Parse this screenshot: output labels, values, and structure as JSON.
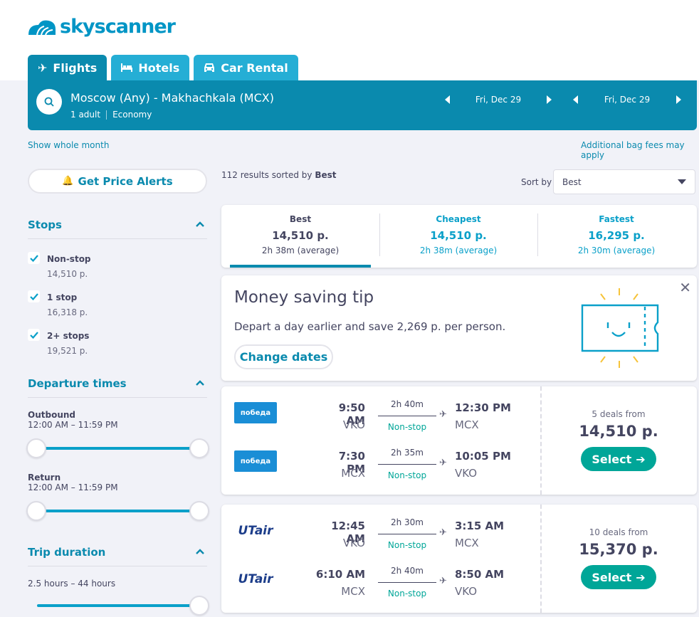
{
  "brand": {
    "name": "skyscanner",
    "color": "#0a8aae",
    "accent": "#00a698"
  },
  "tabs": [
    {
      "label": "Flights",
      "icon": "plane-icon"
    },
    {
      "label": "Hotels",
      "icon": "bed-icon"
    },
    {
      "label": "Car Rental",
      "icon": "car-icon"
    }
  ],
  "search": {
    "route": "Moscow (Any) - Makhachkala (MCX)",
    "travellers": "1 adult",
    "cabin": "Economy",
    "depart_date": "Fri, Dec 29",
    "return_date": "Fri, Dec 29"
  },
  "links": {
    "whole_month": "Show whole month",
    "bag_fees": "Additional bag fees may apply"
  },
  "sidebar": {
    "price_alerts": "Get Price Alerts",
    "stops": {
      "title": "Stops",
      "options": [
        {
          "label": "Non-stop",
          "price": "14,510 р."
        },
        {
          "label": "1 stop",
          "price": "16,318 р."
        },
        {
          "label": "2+ stops",
          "price": "19,521 р."
        }
      ]
    },
    "departure": {
      "title": "Departure times",
      "outbound_label": "Outbound",
      "outbound_range": "12:00 AM – 11:59 PM",
      "return_label": "Return",
      "return_range": "12:00 AM – 11:59 PM"
    },
    "duration": {
      "title": "Trip duration",
      "range": "2.5 hours – 44 hours"
    }
  },
  "results": {
    "count_text": "112 results sorted by ",
    "sorted_by": "Best",
    "sort_label": "Sort by",
    "sort_value": "Best"
  },
  "sort_tabs": [
    {
      "title": "Best",
      "price": "14,510 р.",
      "duration": "2h 38m (average)"
    },
    {
      "title": "Cheapest",
      "price": "14,510 р.",
      "duration": "2h 38m (average)"
    },
    {
      "title": "Fastest",
      "price": "16,295 р.",
      "duration": "2h 30m (average)"
    }
  ],
  "tip": {
    "title": "Money saving tip",
    "text": "Depart a day earlier and save 2,269 р. per person.",
    "button": "Change dates"
  },
  "itineraries": [
    {
      "deals": "5 deals from",
      "price": "14,510 р.",
      "select": "Select",
      "legs": [
        {
          "airline": "победа",
          "dep_time": "9:50 AM",
          "dep_ap": "VKO",
          "duration": "2h 40m",
          "stops": "Non-stop",
          "arr_time": "12:30 PM",
          "arr_ap": "MCX"
        },
        {
          "airline": "победа",
          "dep_time": "7:30 PM",
          "dep_ap": "MCX",
          "duration": "2h 35m",
          "stops": "Non-stop",
          "arr_time": "10:05 PM",
          "arr_ap": "VKO"
        }
      ]
    },
    {
      "deals": "10 deals from",
      "price": "15,370 р.",
      "select": "Select",
      "legs": [
        {
          "airline": "UTair",
          "dep_time": "12:45 AM",
          "dep_ap": "VKO",
          "duration": "2h 30m",
          "stops": "Non-stop",
          "arr_time": "3:15 AM",
          "arr_ap": "MCX"
        },
        {
          "airline": "UTair",
          "dep_time": "6:10 AM",
          "dep_ap": "MCX",
          "duration": "2h 40m",
          "stops": "Non-stop",
          "arr_time": "8:50 AM",
          "arr_ap": "VKO"
        }
      ]
    }
  ]
}
